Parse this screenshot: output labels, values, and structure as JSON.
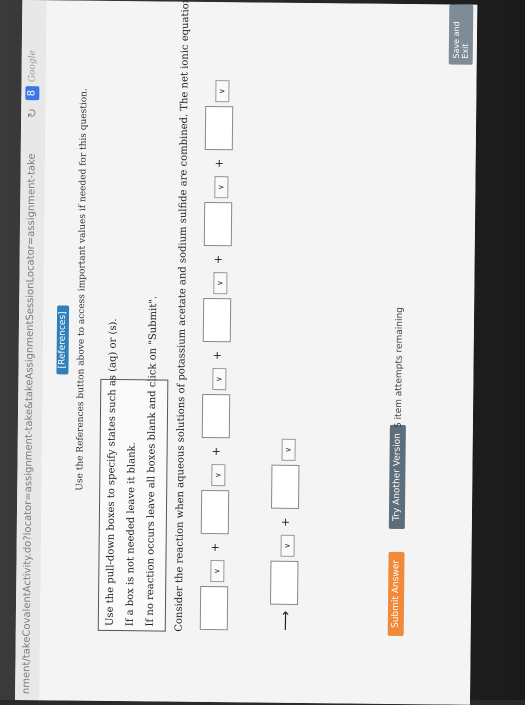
{
  "browser": {
    "url": "nment/takeCovalentActivity.do?locator=assignment-take&takeAssignmentSessionLocator=assignment-take",
    "reload_icon": "reload-icon",
    "search_engine": "Google",
    "google_icon": "8"
  },
  "header": {
    "references_label": "[References]",
    "references_note": "Use the References button above to access important values if needed for this question."
  },
  "instructions": {
    "line1": "Use the pull-down boxes to specify states such as (aq) or (s).",
    "line2": "If a box is not needed leave it blank.",
    "line3": "If no reaction occurs leave all boxes blank and click on \"Submit\"."
  },
  "question": {
    "text": "Consider the reaction when aqueous solutions of potassium acetate and sodium sulfide are combined. The net ionic equation for this reaction is:"
  },
  "equation": {
    "plus": "+",
    "arrow": "⟶",
    "select_glyph": "∨"
  },
  "buttons": {
    "submit": "Submit Answer",
    "another": "Try Another Version",
    "save_exit": "Save and Exit"
  },
  "status": {
    "attempts": "5 item attempts remaining"
  }
}
